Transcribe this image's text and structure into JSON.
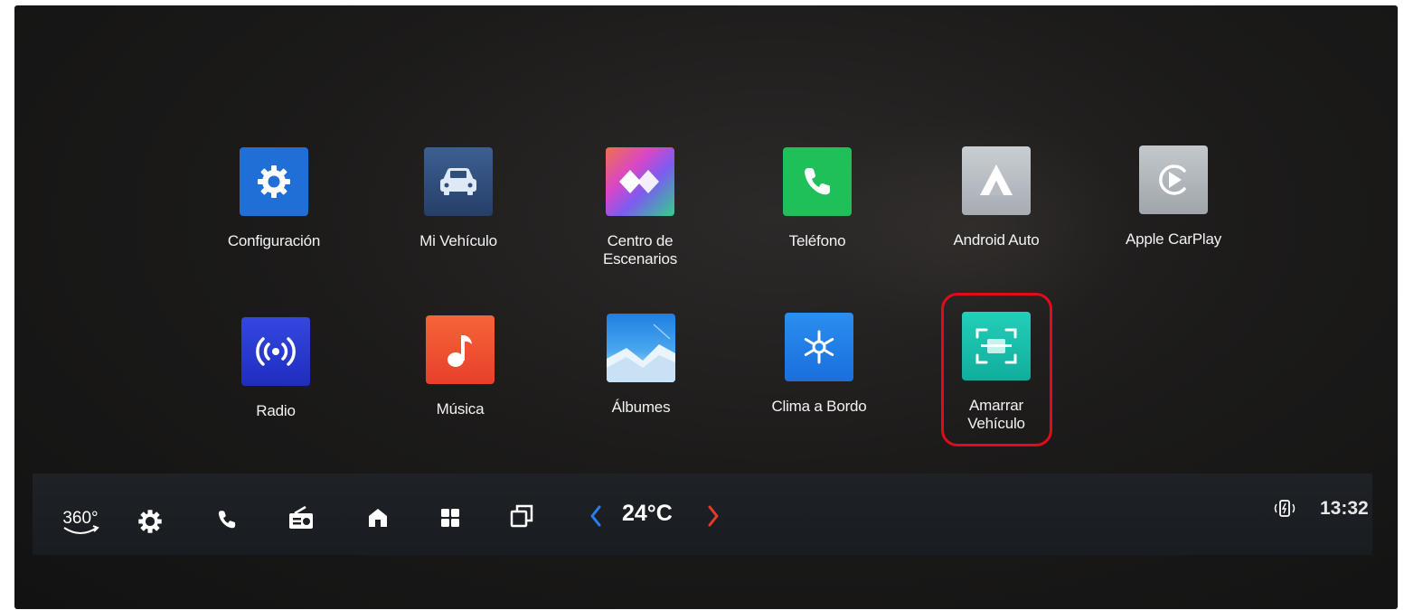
{
  "apps_row1": [
    {
      "label": "Configuración",
      "icon": "settings-gear-icon",
      "color": "#1f6fd6"
    },
    {
      "label": "Mi Vehículo",
      "icon": "car-icon",
      "color": "#2d4b7a"
    },
    {
      "label": "Centro de\nEscenarios",
      "icon": "scenarios-diamond-icon",
      "color": "#c45ad0"
    },
    {
      "label": "Teléfono",
      "icon": "phone-icon",
      "color": "#1fbf5a"
    },
    {
      "label": "Android Auto",
      "icon": "android-auto-icon",
      "color": "#b8bec4"
    },
    {
      "label": "Apple CarPlay",
      "icon": "carplay-icon",
      "color": "#aeb3b8"
    }
  ],
  "apps_row2": [
    {
      "label": "Radio",
      "icon": "radio-waves-icon",
      "color": "#2a3bd0"
    },
    {
      "label": "Música",
      "icon": "music-note-icon",
      "color": "#f0522a"
    },
    {
      "label": "Álbumes",
      "icon": "album-mountain-icon",
      "color": "#2a8be0"
    },
    {
      "label": "Clima a Bordo",
      "icon": "snowflake-icon",
      "color": "#1f7fe8"
    },
    {
      "label": "Amarrar\nVehículo",
      "icon": "tie-down-scan-icon",
      "color": "#1fc4b0"
    }
  ],
  "highlighted_app": "Amarrar\nVehículo",
  "highlight_color": "#e00b1b",
  "dock": {
    "camera_label": "360°",
    "temperature": "24°C",
    "time": "13:32",
    "left_arrow_color": "#2a7ff0",
    "right_arrow_color": "#e83a2a",
    "icons": [
      "camera-360-icon",
      "settings-gear-icon",
      "phone-icon",
      "radio-icon",
      "home-icon",
      "apps-grid-icon",
      "windows-icon",
      "temp-down-icon",
      "temp-up-icon",
      "phone-charge-icon"
    ]
  }
}
